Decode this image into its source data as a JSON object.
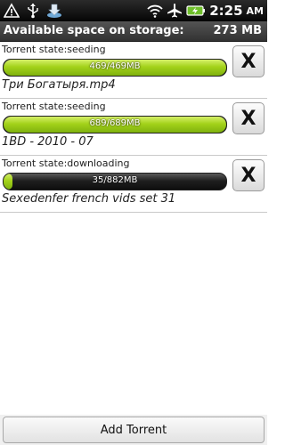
{
  "status_bar": {
    "time": "2:25",
    "ampm": "AM",
    "icons": [
      "warning-icon",
      "usb-icon",
      "download-icon",
      "wifi-icon",
      "airplane-icon",
      "battery-charging-icon"
    ]
  },
  "storage": {
    "label": "Available space on storage:",
    "value": "273 MB"
  },
  "torrents": [
    {
      "state": "Torrent state:seeding",
      "progress_text": "469/469MB",
      "progress": 1.0,
      "name": "Три Богатыря.mp4",
      "remove_label": "X"
    },
    {
      "state": "Torrent state:seeding",
      "progress_text": "689/689MB",
      "progress": 1.0,
      "name": "1BD - 2010 - 07",
      "remove_label": "X"
    },
    {
      "state": "Torrent state:downloading",
      "progress_text": "35/882MB",
      "progress": 0.04,
      "name": "Sexedenfer french vids set 31",
      "remove_label": "X"
    }
  ],
  "footer": {
    "add_button": "Add Torrent"
  }
}
